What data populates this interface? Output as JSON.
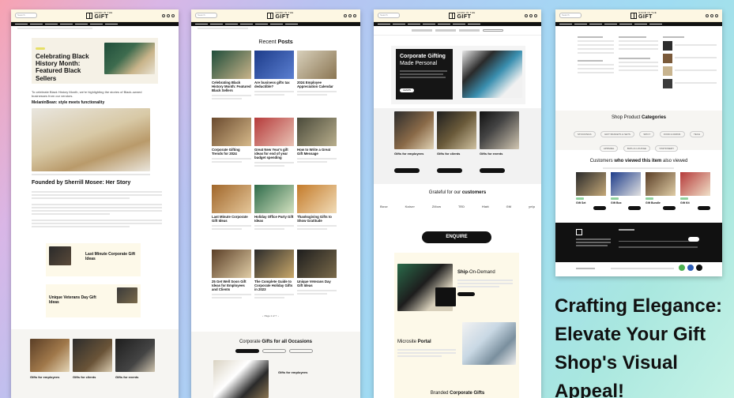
{
  "brand": {
    "line1": "GOOD IN THE",
    "line2": "GIFT"
  },
  "header": {
    "search_placeholder": "Search"
  },
  "tagline": "Crafting Elegance: Elevate Your Gift Shop's Visual Appeal!",
  "panel1": {
    "hero_title": "Celebrating Black History Month: Featured Black Sellers",
    "intro": "To celebrate Black History Month, we're highlighting the stories of Black-owned businesses from our vendors.",
    "section_heading": "MelaninBean: style meets functionality",
    "founder_heading": "Founded by Sherrill Mosee: Her Story",
    "related1": "Last Minute Corporate Gift Ideas",
    "related2": "Unique Veterans Day Gift Ideas",
    "cat1": "Gifts for employees",
    "cat2": "Gifts for clients",
    "cat3": "Gifts for events"
  },
  "panel2": {
    "heading_plain": "Recent ",
    "heading_bold": "Posts",
    "posts": [
      "Celebrating Black History Month: Featured Black Sellers",
      "Are business gifts tax deductible?",
      "2024 Employee Appreciation Calendar",
      "Corporate Gifting Trends for 2024",
      "Great New Year's gift ideas for end of year budget spending",
      "How to Write a Great Gift Message",
      "Last Minute Corporate Gift Ideas",
      "Holiday Office Party Gift Ideas",
      "Thanksgiving Gifts to Show Gratitude",
      "25 Get Well Soon Gift Ideas for Employees and Clients",
      "The Complete Guide to Corporate Holiday Gifts in 2023",
      "Unique Veterans Day Gift Ideas"
    ],
    "occasions_plain": "Corporate ",
    "occasions_bold": "Gifts for all Occasions",
    "occasion_card": "Gifts for employees"
  },
  "panel3": {
    "hero_title1": "Corporate Gifting",
    "hero_title2": "Made Personal",
    "hero_btn": "LEARN MORE",
    "cat1": "Gifts for employees",
    "cat2": "Gifts for clients",
    "cat3": "Gifts for events",
    "grateful_plain": "Grateful for our ",
    "grateful_bold": "customers",
    "client_logos": [
      "Bose",
      "Kaiser",
      "Zillow",
      "TED",
      "Hiatt",
      "GM",
      "yelp"
    ],
    "enquire": "ENQUIRE",
    "ship_bold": "Ship",
    "ship_plain": "-On-Demand",
    "microsite_plain": "Microsite ",
    "microsite_bold": "Portal",
    "branded_plain": "Branded ",
    "branded_bold": "Corporate Gifts"
  },
  "panel4": {
    "shop_plain": "Shop Product ",
    "shop_bold": "Categories",
    "category_chips": [
      "STOCKINGS",
      "GIFT BASKETS & SETS",
      "SPICY",
      "FOOD & DRINK",
      "TECH",
      "APPAREL",
      "BATH & LOUNGE",
      "STATIONERY"
    ],
    "viewed_plain1": "Customers ",
    "viewed_bold": "who viewed this item",
    "viewed_plain2": " also viewed",
    "products": [
      "Gift Set",
      "Gift Box",
      "Gift Bundle",
      "Gift Kit"
    ]
  }
}
